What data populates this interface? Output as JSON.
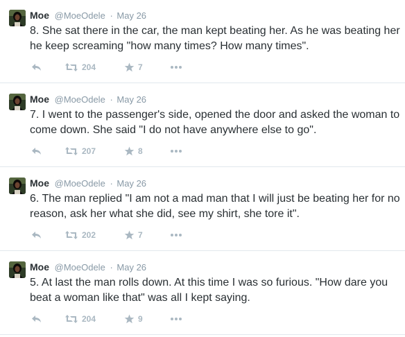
{
  "tweets": [
    {
      "name": "Moe",
      "handle": "@MoeOdele",
      "separator": "·",
      "date": "May 26",
      "text": "8. She sat there in the car, the man kept beating her. As he was beating her he keep screaming \"how many times? How many times\".",
      "retweets": "204",
      "favorites": "7"
    },
    {
      "name": "Moe",
      "handle": "@MoeOdele",
      "separator": "·",
      "date": "May 26",
      "text": "7. I went to the passenger's side, opened the door and asked the woman to come down. She said \"I do not have anywhere else to go\".",
      "retweets": "207",
      "favorites": "8"
    },
    {
      "name": "Moe",
      "handle": "@MoeOdele",
      "separator": "·",
      "date": "May 26",
      "text": "6. The man replied \"I am not a mad man that I will just be beating her for no reason, ask her what she did, see my shirt, she tore it\".",
      "retweets": "202",
      "favorites": "7"
    },
    {
      "name": "Moe",
      "handle": "@MoeOdele",
      "separator": "·",
      "date": "May 26",
      "text": "5. At last the man rolls down. At this time I was so furious. \"How dare you beat a woman like that\" was all I kept saying.",
      "retweets": "204",
      "favorites": "9"
    }
  ],
  "icons": {
    "reply": "reply-icon",
    "retweet": "retweet-icon",
    "favorite": "star-icon",
    "more": "more-icon"
  },
  "colors": {
    "text": "#292f33",
    "muted": "#8899a6",
    "action": "#aab8c2",
    "divider": "#e1e8ed"
  }
}
